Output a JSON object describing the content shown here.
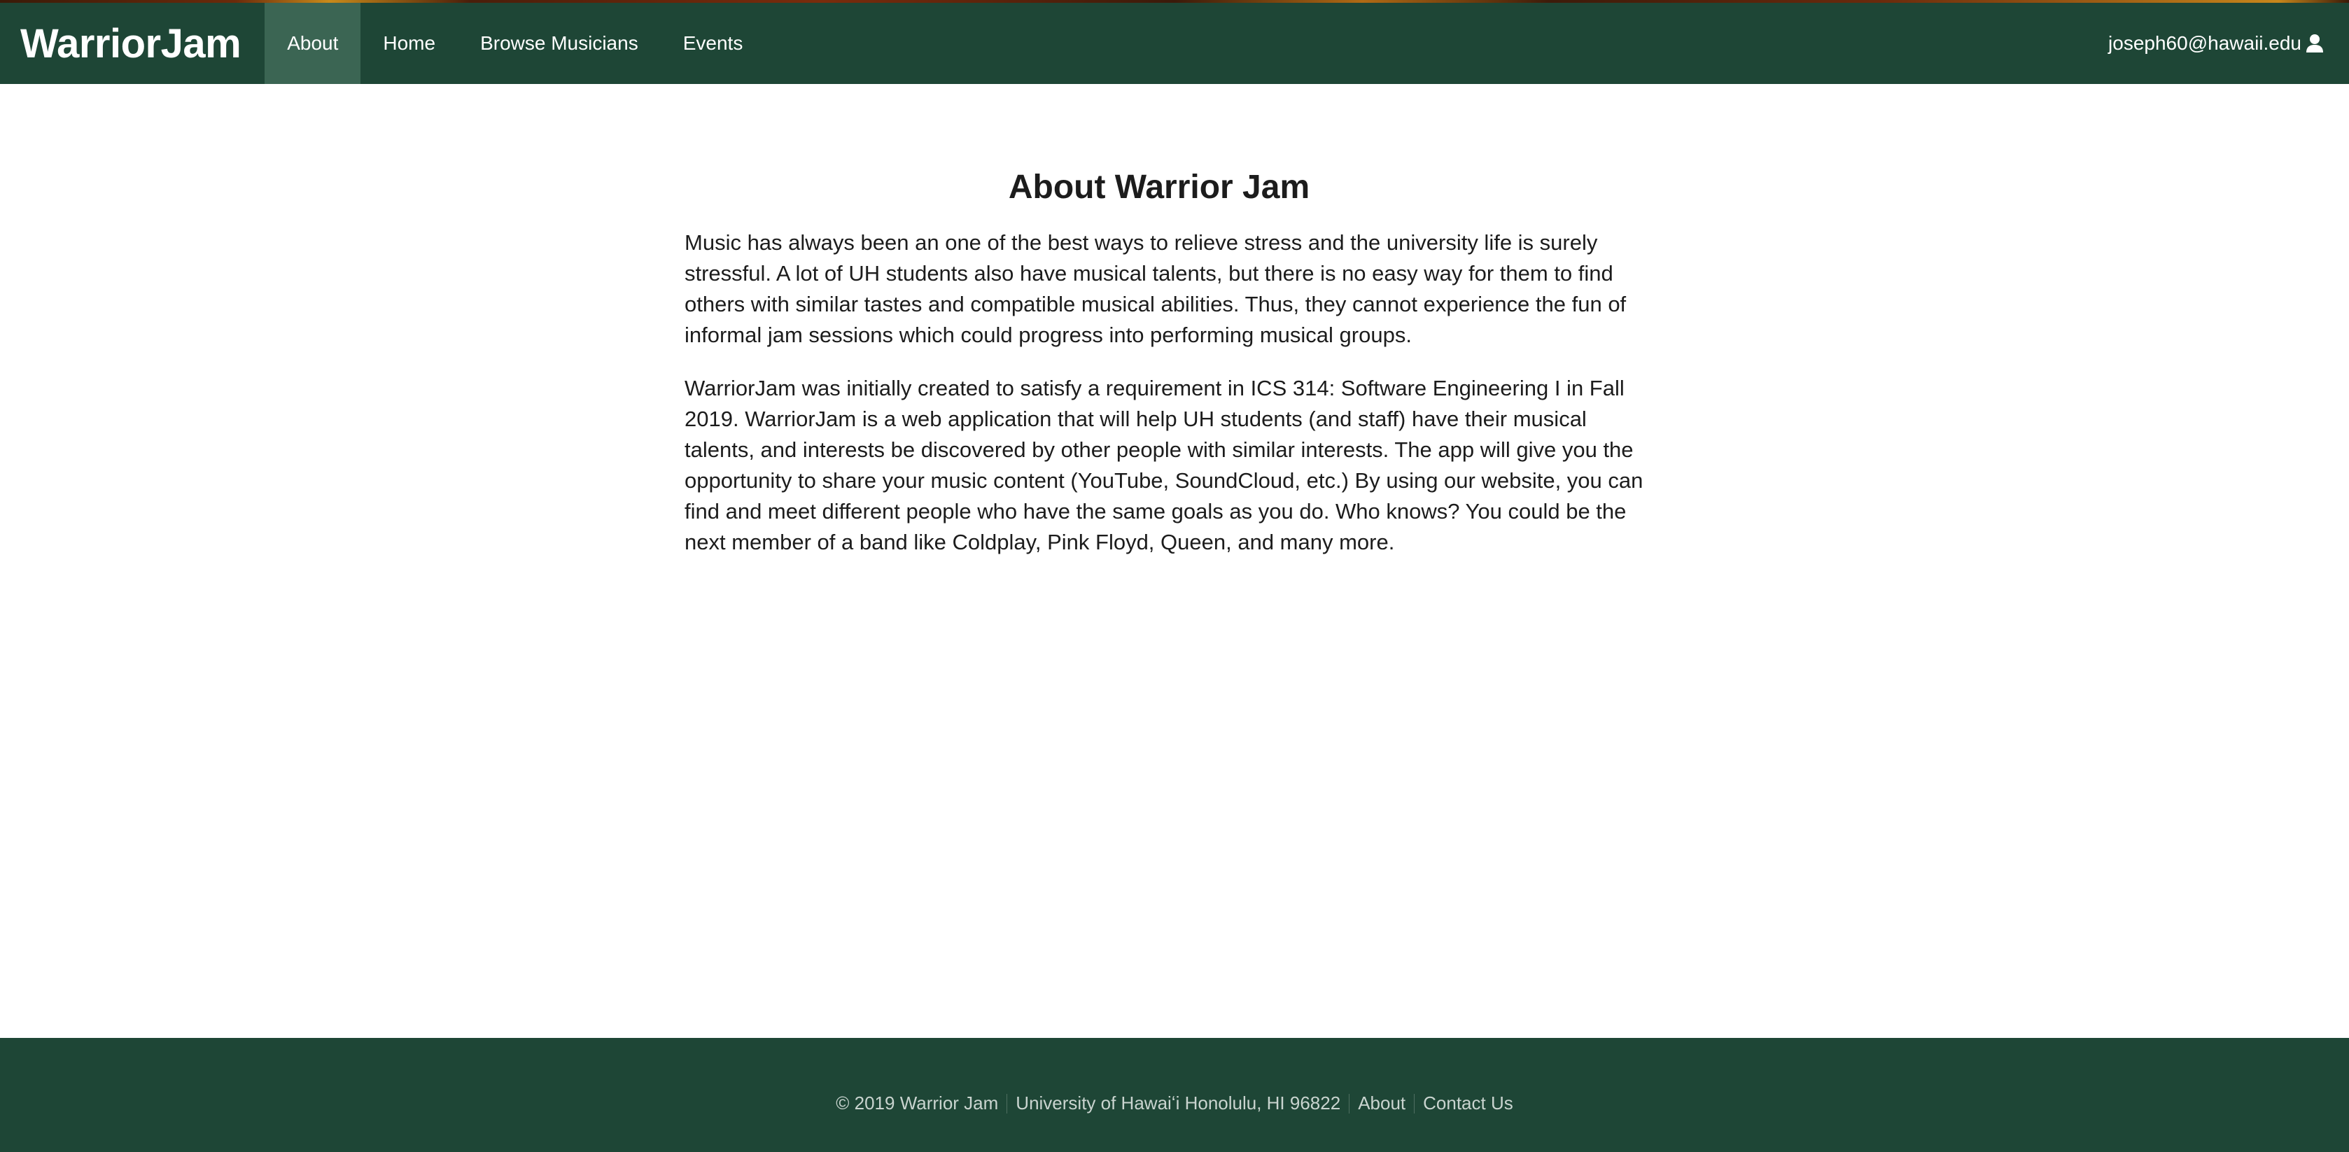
{
  "navbar": {
    "brand": "WarriorJam",
    "items": [
      {
        "label": "About",
        "active": true
      },
      {
        "label": "Home",
        "active": false
      },
      {
        "label": "Browse Musicians",
        "active": false
      },
      {
        "label": "Events",
        "active": false
      }
    ],
    "user_email": "joseph60@hawaii.edu",
    "user_icon": "user-icon"
  },
  "main": {
    "title": "About Warrior Jam",
    "paragraphs": [
      "Music has always been an one of the best ways to relieve stress and the university life is surely stressful. A lot of UH students also have musical talents, but there is no easy way for them to find others with similar tastes and compatible musical abilities. Thus, they cannot experience the fun of informal jam sessions which could progress into performing musical groups.",
      "WarriorJam was initially created to satisfy a requirement in ICS 314: Software Engineering I in Fall 2019. WarriorJam is a web application that will help UH students (and staff) have their musical talents, and interests be discovered by other people with similar interests. The app will give you the opportunity to share your music content (YouTube, SoundCloud, etc.) By using our website, you can find and meet different people who have the same goals as you do. Who knows? You could be the next member of a band like Coldplay, Pink Floyd, Queen, and many more."
    ]
  },
  "footer": {
    "copyright": "© 2019 Warrior Jam",
    "address": "University of Hawaiʻi Honolulu, HI 96822",
    "about": "About",
    "contact": "Contact Us"
  },
  "colors": {
    "navbar_bg": "#1e4636",
    "active_nav_bg": "#3b6553",
    "footer_bg": "#1e4636",
    "text": "#1c1c1c"
  }
}
